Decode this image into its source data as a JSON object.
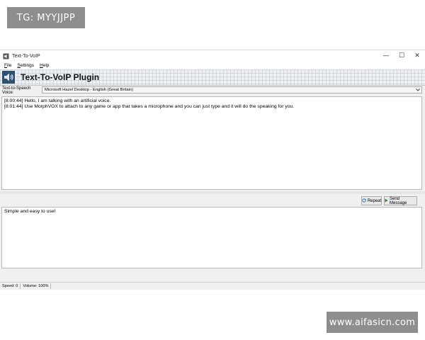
{
  "watermarks": {
    "top": "TG: MYYJJPP",
    "bottom": "www.aifasicn.com"
  },
  "window": {
    "title": "Text-To-VoIP",
    "controls": [
      "—",
      "☐",
      "✕"
    ]
  },
  "menu": {
    "items": [
      {
        "accel": "F",
        "rest": "ile"
      },
      {
        "accel": "S",
        "rest": "ettings"
      },
      {
        "accel": "H",
        "rest": "elp"
      }
    ]
  },
  "banner": {
    "title": "Text-To-VoIP Plugin",
    "icon": "speaker-icon"
  },
  "voice": {
    "label": "Text-to-Speech Voice:",
    "selected": "Microsoft Hazel Desktop - English (Great Britain)"
  },
  "chat": {
    "lines": [
      "[8:00:44] Hello, I am talking with an artificial voice.",
      "[8:01:44] Use MorphVOX to attach to any game or app that takes a microphone and you can just type and it will do the speaking for you."
    ]
  },
  "buttons": {
    "repeat": "Repeat",
    "send": "Send Message"
  },
  "compose": {
    "value": "Simple and easy to use!"
  },
  "status": {
    "speed": "Speed: 0",
    "volume": "Volume: 100%"
  }
}
